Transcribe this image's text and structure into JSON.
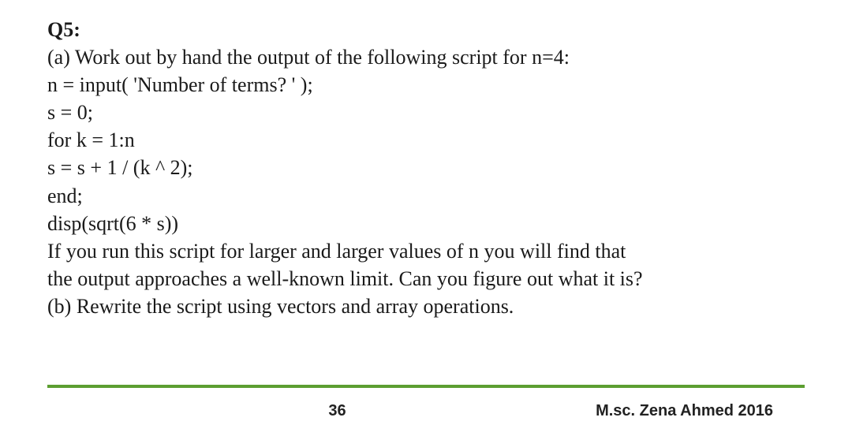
{
  "question": {
    "label": "Q5:",
    "part_a_intro": "(a) Work out by hand the output of the following script for n=4:",
    "code": [
      "n = input( 'Number of terms? ' );",
      "s = 0;",
      "for k = 1:n",
      "s = s + 1 / (k ^ 2);",
      "end;",
      "disp(sqrt(6 * s))"
    ],
    "part_a_followup1": "If you run this script for larger and larger values of n you will find that",
    "part_a_followup2": "the output approaches a well-known limit. Can you figure out what it is?",
    "part_b": "(b) Rewrite the script using vectors and array operations."
  },
  "footer": {
    "page_number": "36",
    "author": "M.sc. Zena Ahmed  2016"
  }
}
